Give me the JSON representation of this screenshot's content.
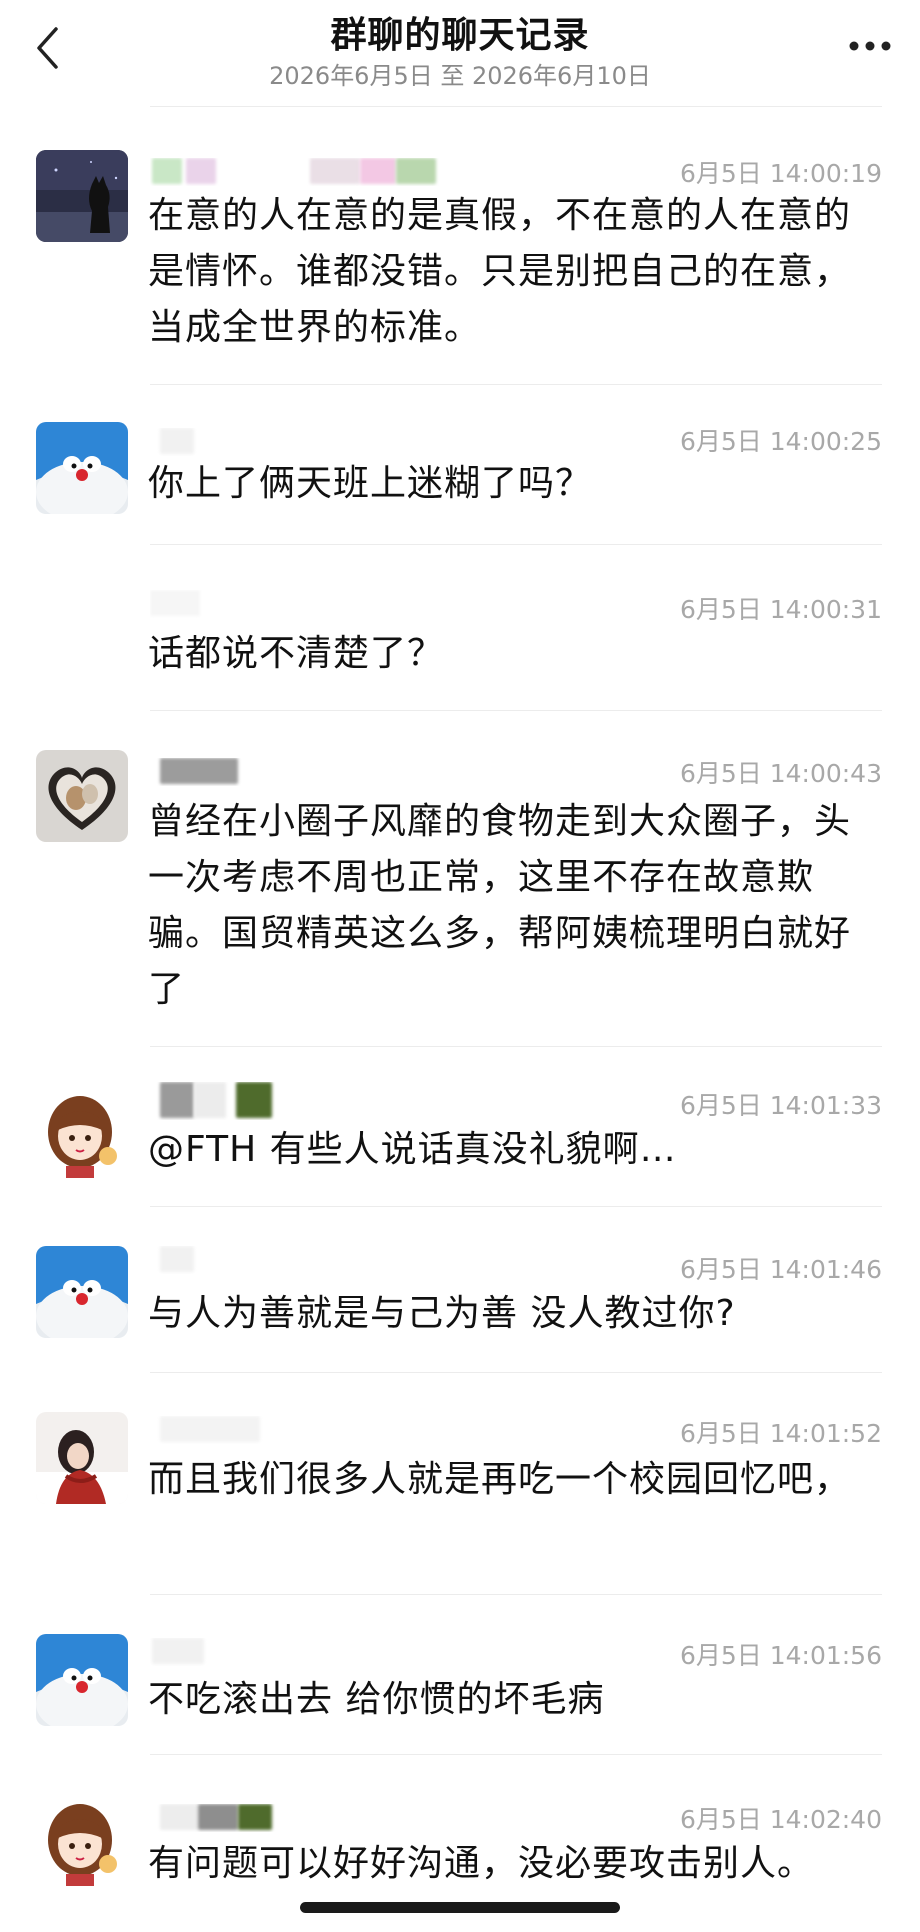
{
  "header": {
    "title": "群聊的聊天记录",
    "subtitle": "2026年6月5日 至 2026年6月10日",
    "back_icon": "chevron-left-icon",
    "more_icon": "more-dots-icon"
  },
  "messages": [
    {
      "avatar": "cat-silhouette-night",
      "time": "6月5日 14:00:19",
      "text": "在意的人在意的是真假，不在意的人在意的是情怀。谁都没错。只是别把自己的在意，当成全世界的标准。"
    },
    {
      "avatar": "doraemon",
      "time": "6月5日 14:00:25",
      "text": "你上了俩天班上迷糊了吗？"
    },
    {
      "avatar": "none",
      "time": "6月5日 14:00:31",
      "text": "话都说不清楚了？"
    },
    {
      "avatar": "heart-frame-cat",
      "time": "6月5日 14:00:43",
      "text": "曾经在小圈子风靡的食物走到大众圈子，头一次考虑不周也正常，这里不存在故意欺骗。国贸精英这么多，帮阿姨梳理明白就好了"
    },
    {
      "avatar": "anime-girl",
      "time": "6月5日 14:01:33",
      "text": "@FTH 有些人说话真没礼貌啊…"
    },
    {
      "avatar": "doraemon",
      "time": "6月5日 14:01:46",
      "text": "与人为善就是与己为善 没人教过你?"
    },
    {
      "avatar": "girl-red-scarf",
      "time": "6月5日 14:01:52",
      "text": "而且我们很多人就是再吃一个校园回忆吧，"
    },
    {
      "avatar": "doraemon",
      "time": "6月5日 14:01:56",
      "text": "不吃滚出去 给你惯的坏毛病"
    },
    {
      "avatar": "anime-girl",
      "time": "6月5日 14:02:40",
      "text": "有问题可以好好沟通，没必要攻击别人。"
    }
  ],
  "colors": {
    "text": "#111111",
    "time": "#a8a8a8",
    "subtitle": "#8a8a8a",
    "divider": "#ececec",
    "doraemon_blue": "#2e86d6"
  }
}
